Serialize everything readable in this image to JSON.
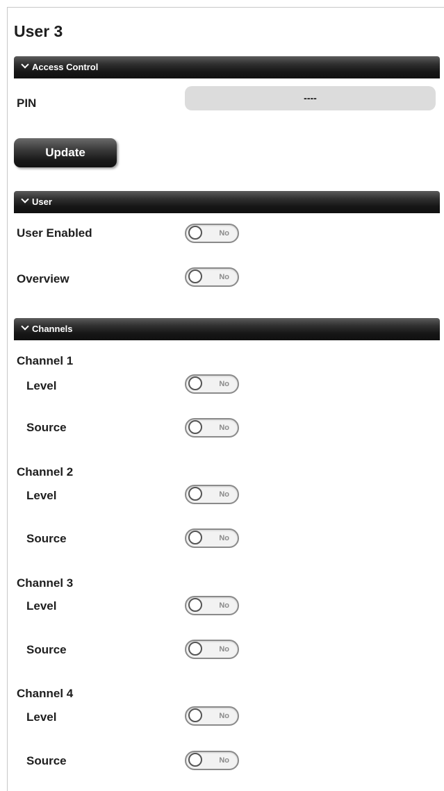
{
  "page": {
    "title": "User 3"
  },
  "access_control": {
    "header": "Access Control",
    "pin_label": "PIN",
    "pin_value": "----",
    "update_label": "Update"
  },
  "user": {
    "header": "User",
    "fields": [
      {
        "label": "User Enabled",
        "state": "No"
      },
      {
        "label": "Overview",
        "state": "No"
      }
    ]
  },
  "channels": {
    "header": "Channels",
    "items": [
      {
        "name": "Channel 1",
        "level": {
          "label": "Level",
          "state": "No"
        },
        "source": {
          "label": "Source",
          "state": "No"
        }
      },
      {
        "name": "Channel 2",
        "level": {
          "label": "Level",
          "state": "No"
        },
        "source": {
          "label": "Source",
          "state": "No"
        }
      },
      {
        "name": "Channel 3",
        "level": {
          "label": "Level",
          "state": "No"
        },
        "source": {
          "label": "Source",
          "state": "No"
        }
      },
      {
        "name": "Channel 4",
        "level": {
          "label": "Level",
          "state": "No"
        },
        "source": {
          "label": "Source",
          "state": "No"
        }
      }
    ]
  },
  "icons": {
    "section_toggle": "chevron-down-icon"
  },
  "colors": {
    "header_bg": "#161616",
    "header_text": "#ffffff",
    "pin_field_bg": "#dcdcdc",
    "toggle_off_text": "#8a8a8a"
  }
}
